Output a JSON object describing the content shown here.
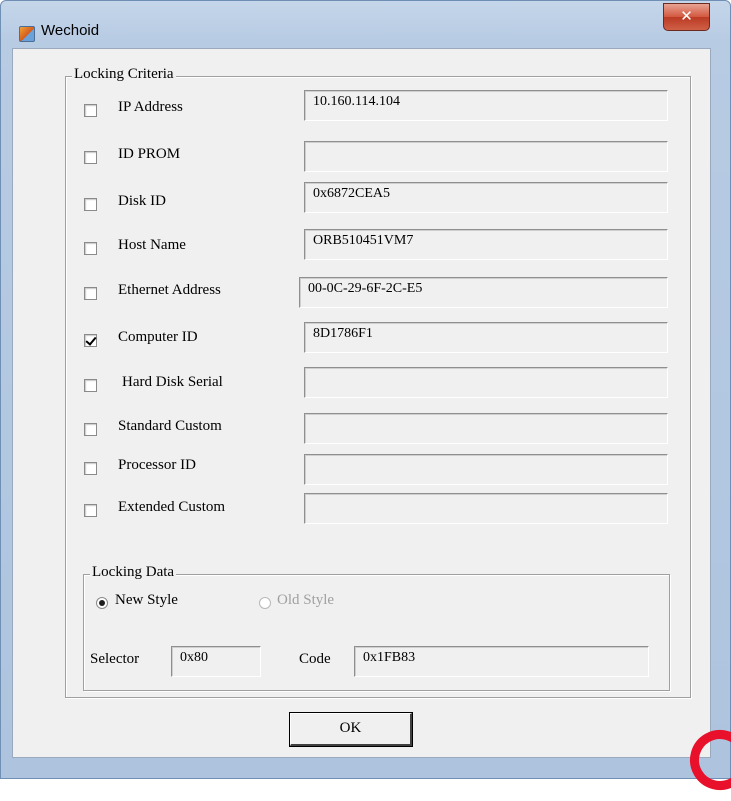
{
  "window": {
    "title": "Wechoid",
    "close_glyph": "✕"
  },
  "locking_criteria": {
    "label": "Locking Criteria",
    "rows": [
      {
        "label": "IP Address",
        "value": "10.160.114.104",
        "checked": false
      },
      {
        "label": "ID PROM",
        "value": "",
        "checked": false
      },
      {
        "label": "Disk ID",
        "value": "0x6872CEA5",
        "checked": false
      },
      {
        "label": "Host Name",
        "value": "ORB510451VM7",
        "checked": false
      },
      {
        "label": "Ethernet Address",
        "value": "00-0C-29-6F-2C-E5",
        "checked": false
      },
      {
        "label": "Computer ID",
        "value": "8D1786F1",
        "checked": true
      },
      {
        "label": "Hard Disk Serial",
        "value": "",
        "checked": false
      },
      {
        "label": "Standard Custom",
        "value": "",
        "checked": false
      },
      {
        "label": "Processor ID",
        "value": "",
        "checked": false
      },
      {
        "label": "Extended Custom",
        "value": "",
        "checked": false
      }
    ]
  },
  "locking_data": {
    "label": "Locking Data",
    "new_style": {
      "label": "New Style",
      "selected": true
    },
    "old_style": {
      "label": "Old Style",
      "selected": false,
      "disabled": true
    },
    "selector": {
      "label": "Selector",
      "value": "0x80"
    },
    "code": {
      "label": "Code",
      "value": "0x1FB83"
    }
  },
  "ok_button": {
    "label": "OK"
  },
  "colors": {
    "title_bar": "#b7cbe3",
    "close_button": "#c9452e",
    "dialog_bg": "#f0f0f0",
    "corner_mark": "#e8102b"
  }
}
